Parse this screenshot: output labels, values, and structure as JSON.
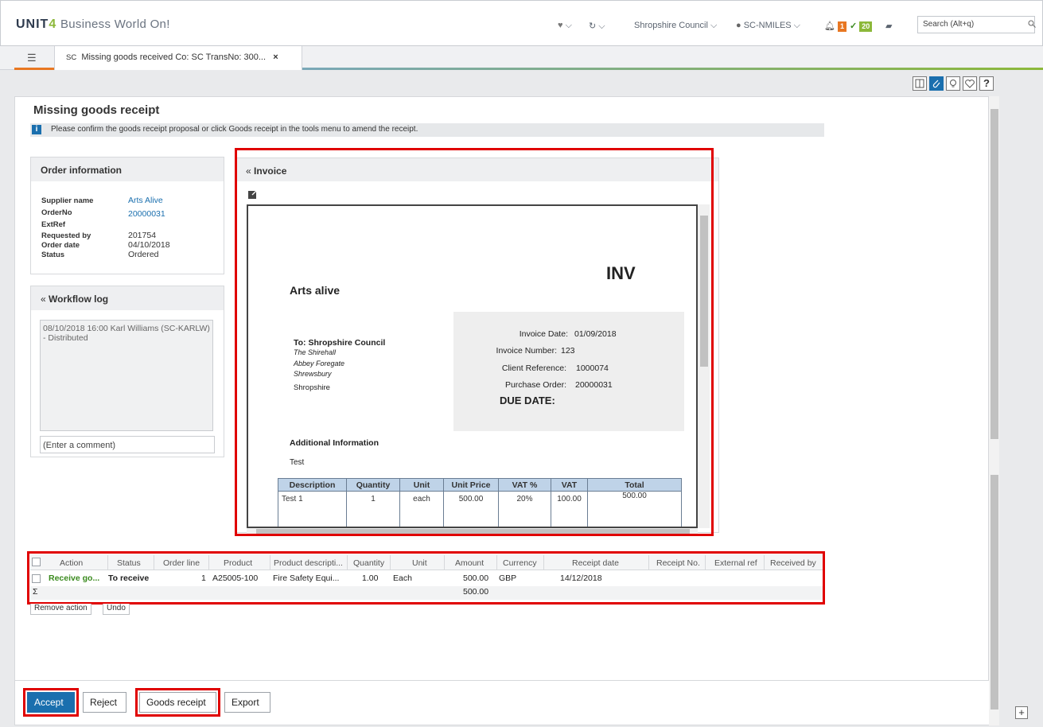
{
  "app": {
    "brand": "UNIT",
    "brand_digit": "4",
    "product": "Business World On!",
    "client": "Shropshire Council",
    "user": "SC-NMILES",
    "alerts_count": "1",
    "tasks_count": "20",
    "search_placeholder": "Search (Alt+q)"
  },
  "tab": {
    "prefix": "SC",
    "title": "Missing goods received Co: SC TransNo: 300...",
    "close": "×"
  },
  "page": {
    "title": "Missing goods receipt",
    "info": "Please confirm the goods receipt proposal or click Goods receipt in the tools menu to amend the receipt."
  },
  "order_info": {
    "heading": "Order information",
    "rows": [
      {
        "label": "Supplier name",
        "value": "Arts Alive"
      },
      {
        "label": "OrderNo",
        "value": "20000031"
      },
      {
        "label": "ExtRef",
        "value": ""
      },
      {
        "label": "Requested by",
        "value": "201754"
      },
      {
        "label": "Order date",
        "value": "04/10/2018"
      },
      {
        "label": "Status",
        "value": "Ordered"
      }
    ]
  },
  "workflow": {
    "heading": "Workflow log",
    "entry": "08/10/2018 16:00 Karl Williams (SC-KARLW) - Distributed",
    "comment_placeholder": "(Enter a comment)"
  },
  "invoice": {
    "heading": "Invoice",
    "company": "Arts alive",
    "doc_type": "INV",
    "to_line": "To: Shropshire Council",
    "address": [
      "The Shirehall",
      "Abbey Foregate",
      "Shrewsbury",
      "Shropshire"
    ],
    "fields": [
      {
        "label": "Invoice Date:",
        "value": "01/09/2018"
      },
      {
        "label": "Invoice Number:",
        "value": "123"
      },
      {
        "label": "Client Reference:",
        "value": "1000074"
      },
      {
        "label": "Purchase Order:",
        "value": "20000031"
      }
    ],
    "due_date_label": "DUE DATE:",
    "additional_heading": "Additional Information",
    "additional_text": "Test",
    "table_headers": [
      "Description",
      "Quantity",
      "Unit",
      "Unit Price",
      "VAT %",
      "VAT",
      "Total"
    ],
    "table_row": [
      "Test 1",
      "1",
      "each",
      "500.00",
      "20%",
      "100.00",
      "500.00"
    ]
  },
  "grid": {
    "headers": [
      "Action",
      "Status",
      "Order line",
      "Product",
      "Product descripti...",
      "Quantity",
      "Unit",
      "Amount",
      "Currency",
      "Receipt date",
      "Receipt No.",
      "External ref",
      "Received by"
    ],
    "row": {
      "action": "Receive go...",
      "status": "To receive",
      "order_line": "1",
      "product": "A25005-100",
      "product_desc": "Fire Safety Equi...",
      "quantity": "1.00",
      "unit": "Each",
      "amount": "500.00",
      "currency": "GBP",
      "receipt_date": "14/12/2018"
    },
    "sum_symbol": "Σ",
    "sum_amount": "500.00",
    "remove_action": "Remove action",
    "undo": "Undo"
  },
  "buttons": {
    "accept": "Accept",
    "reject": "Reject",
    "goods_receipt": "Goods receipt",
    "export": "Export"
  },
  "colors": {
    "accent": "#1a6fae",
    "highlight": "#e00000",
    "link": "#1a6fae",
    "action_green": "#3a8a1e"
  }
}
